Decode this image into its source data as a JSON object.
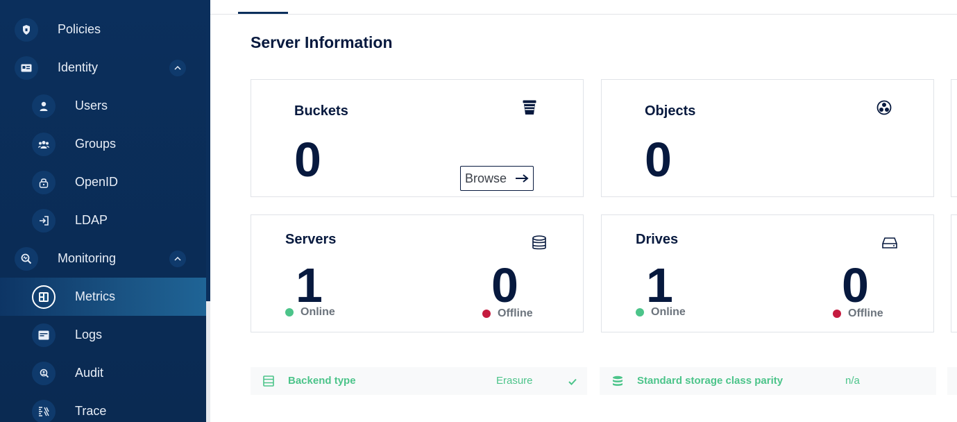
{
  "sidebar": {
    "items": [
      {
        "label": "Policies",
        "icon": "shield-icon"
      },
      {
        "label": "Identity",
        "icon": "id-card-icon"
      },
      {
        "label": "Users",
        "icon": "user-icon"
      },
      {
        "label": "Groups",
        "icon": "groups-icon"
      },
      {
        "label": "OpenID",
        "icon": "openid-lock-icon"
      },
      {
        "label": "LDAP",
        "icon": "login-icon"
      },
      {
        "label": "Monitoring",
        "icon": "monitoring-icon"
      },
      {
        "label": "Metrics",
        "icon": "metrics-icon"
      },
      {
        "label": "Logs",
        "icon": "logs-icon"
      },
      {
        "label": "Audit",
        "icon": "audit-icon"
      },
      {
        "label": "Trace",
        "icon": "trace-icon"
      }
    ],
    "active": "Metrics"
  },
  "main": {
    "title": "Server Information",
    "cards": {
      "buckets": {
        "title": "Buckets",
        "value": "0",
        "icon": "bucket-icon",
        "browse_label": "Browse"
      },
      "objects": {
        "title": "Objects",
        "value": "0",
        "icon": "objects-icon"
      },
      "servers": {
        "title": "Servers",
        "online": "1",
        "offline": "0",
        "online_label": "Online",
        "offline_label": "Offline",
        "icon": "database-icon"
      },
      "drives": {
        "title": "Drives",
        "online": "1",
        "offline": "0",
        "online_label": "Online",
        "offline_label": "Offline",
        "icon": "drive-icon"
      }
    },
    "info": {
      "backend": {
        "label": "Backend type",
        "value": "Erasure",
        "icon": "storage-rows-icon"
      },
      "parity": {
        "label": "Standard storage class parity",
        "value": "n/a",
        "icon": "storage-stack-icon"
      }
    }
  },
  "colors": {
    "sidebar": "#0b2f5c",
    "text_dark": "#07193e",
    "online": "#4cc48a",
    "offline": "#c51b3f",
    "accent_green": "#4cc48a"
  }
}
